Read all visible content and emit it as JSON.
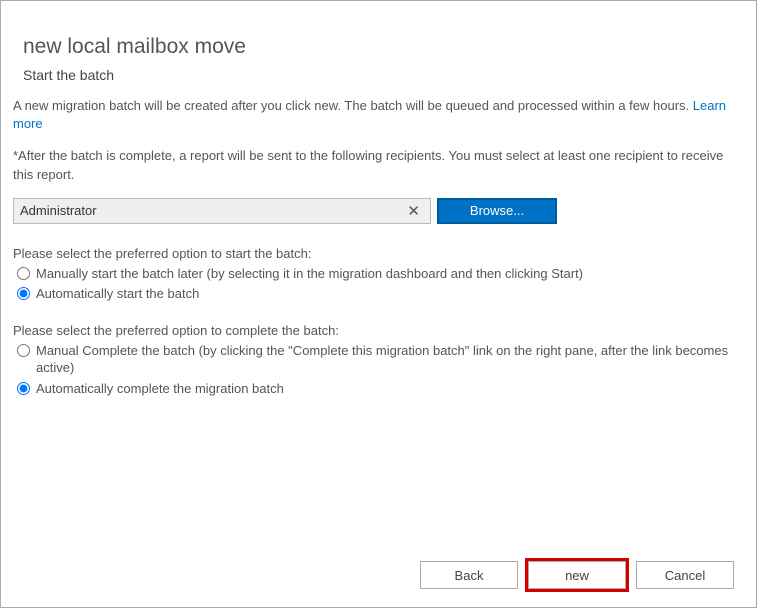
{
  "header": {
    "title": "new local mailbox move",
    "subtitle": "Start the batch"
  },
  "intro": {
    "text": "A new migration batch will be created after you click new. The batch will be queued and processed within a few hours. ",
    "learn_more": "Learn more"
  },
  "recipient": {
    "instruction": "*After the batch is complete, a report will be sent to the following recipients. You must select at least one recipient to receive this report.",
    "value": "Administrator",
    "browse_label": "Browse..."
  },
  "start_options": {
    "label": "Please select the preferred option to start the batch:",
    "manual": "Manually start the batch later (by selecting it in the migration dashboard and then clicking Start)",
    "auto": "Automatically start the batch",
    "selected": "auto"
  },
  "complete_options": {
    "label": "Please select the preferred option to complete the batch:",
    "manual": "Manual Complete the batch (by clicking the \"Complete this migration batch\" link on the right pane, after the link becomes active)",
    "auto": "Automatically complete the migration batch",
    "selected": "auto"
  },
  "footer": {
    "back": "Back",
    "new": "new",
    "cancel": "Cancel"
  }
}
